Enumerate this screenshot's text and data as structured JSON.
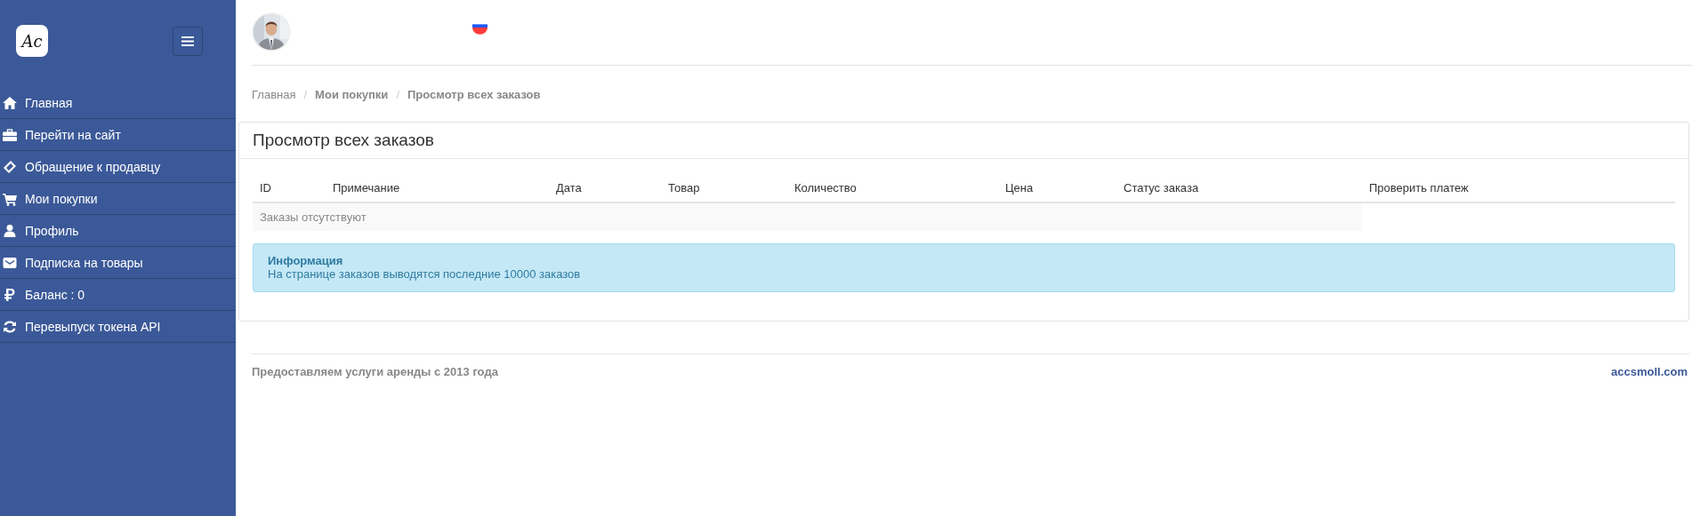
{
  "sidebar": {
    "logo": "Ac",
    "items": [
      {
        "label": "Главная"
      },
      {
        "label": "Перейти на сайт"
      },
      {
        "label": "Обращение к продавцу"
      },
      {
        "label": "Мои покупки"
      },
      {
        "label": "Профиль"
      },
      {
        "label": "Подписка на товары"
      },
      {
        "label": "Баланс : 0"
      },
      {
        "label": "Перевыпуск токена API"
      }
    ]
  },
  "breadcrumb": [
    {
      "label": "Главная",
      "bold": false
    },
    {
      "label": "Мои покупки",
      "bold": true
    },
    {
      "label": "Просмотр всех заказов",
      "bold": true
    }
  ],
  "breadcrumb_separator": "/",
  "panel": {
    "title": "Просмотр всех заказов",
    "table": {
      "columns": [
        "ID",
        "Примечание",
        "Дата",
        "Товар",
        "Количество",
        "Цена",
        "Статус заказа",
        "Проверить платеж"
      ],
      "empty_message": "Заказы отсутствуют"
    },
    "alert": {
      "title": "Информация",
      "text": "На странице заказов выводятся последние 10000 заказов"
    }
  },
  "footer": {
    "text": "Предоставляем услуги аренды с 2013 года",
    "link": "accsmoll.com"
  }
}
